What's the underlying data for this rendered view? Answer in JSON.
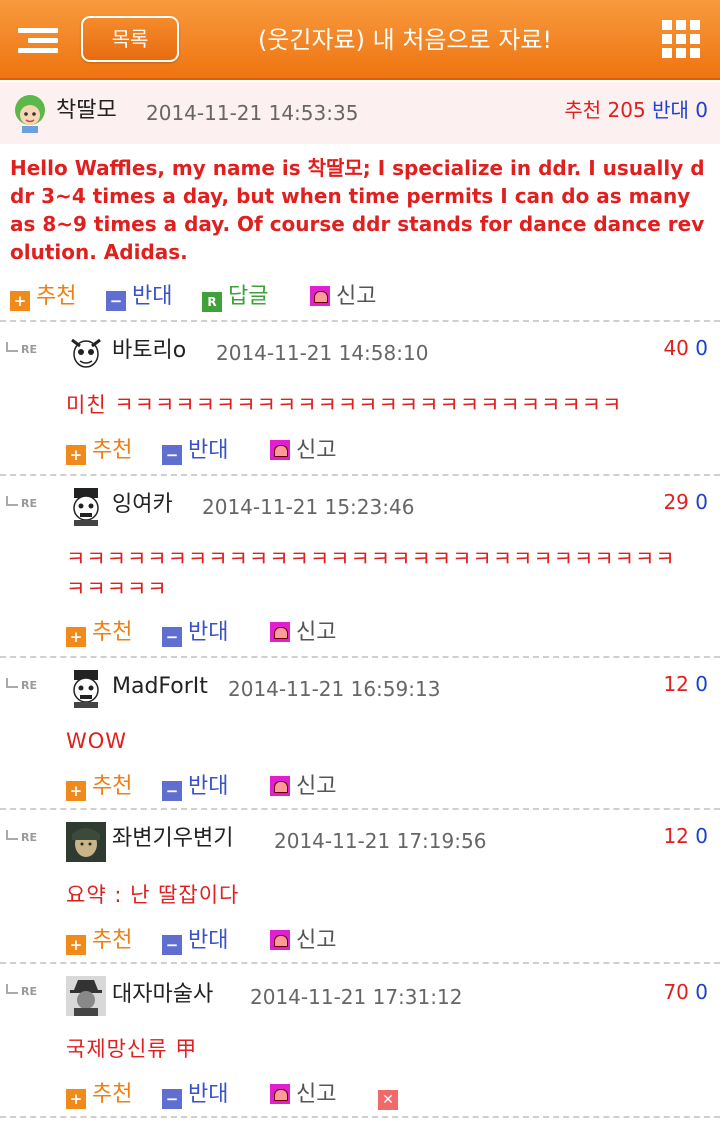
{
  "header": {
    "list_button": "목록",
    "title": "(웃긴자료) 내 처음으로 자료!"
  },
  "op": {
    "author": "착딸모",
    "date": "2014-11-21 14:53:35",
    "recommend_label": "추천",
    "recommend_count": "205",
    "oppose_label": "반대",
    "oppose_count": "0",
    "body": "Hello Waffles, my name is 착딸모; I specialize in ddr. I usually ddr 3~4 times a day, but when time permits I can do as many as 8~9 times a day. Of course ddr stands for dance dance revolution. Adidas.",
    "actions": {
      "up": "추천",
      "down": "반대",
      "reply": "답글",
      "report": "신고"
    }
  },
  "re_label": "RE",
  "action_labels": {
    "up": "추천",
    "down": "반대",
    "report": "신고"
  },
  "comments": [
    {
      "author": "바토리o",
      "date": "2014-11-21 14:58:10",
      "up": "40",
      "down": "0",
      "body": "미친 ㅋㅋㅋㅋㅋㅋㅋㅋㅋㅋㅋㅋㅋㅋㅋㅋㅋㅋㅋㅋㅋㅋㅋㅋㅋ"
    },
    {
      "author": "잉여카",
      "date": "2014-11-21 15:23:46",
      "up": "29",
      "down": "0",
      "body": "ㅋㅋㅋㅋㅋㅋㅋㅋㅋㅋㅋㅋㅋㅋㅋㅋㅋㅋㅋㅋㅋㅋㅋㅋㅋㅋㅋㅋㅋㅋㅋㅋㅋㅋㅋ"
    },
    {
      "author": "MadForIt",
      "date": "2014-11-21 16:59:13",
      "up": "12",
      "down": "0",
      "body": "WOW"
    },
    {
      "author": "좌변기우변기",
      "date": "2014-11-21 17:19:56",
      "up": "12",
      "down": "0",
      "body": "요약 : 난 딸잡이다"
    },
    {
      "author": "대자마술사",
      "date": "2014-11-21 17:31:12",
      "up": "70",
      "down": "0",
      "body": "국제망신류 甲"
    }
  ],
  "colors": {
    "accent": "#ef7410",
    "recommend": "#e0201f",
    "oppose": "#1e3fcf"
  },
  "icons": [
    "menu-icon",
    "grid-icon",
    "plus-icon",
    "minus-icon",
    "reply-icon",
    "siren-icon",
    "delete-icon"
  ]
}
